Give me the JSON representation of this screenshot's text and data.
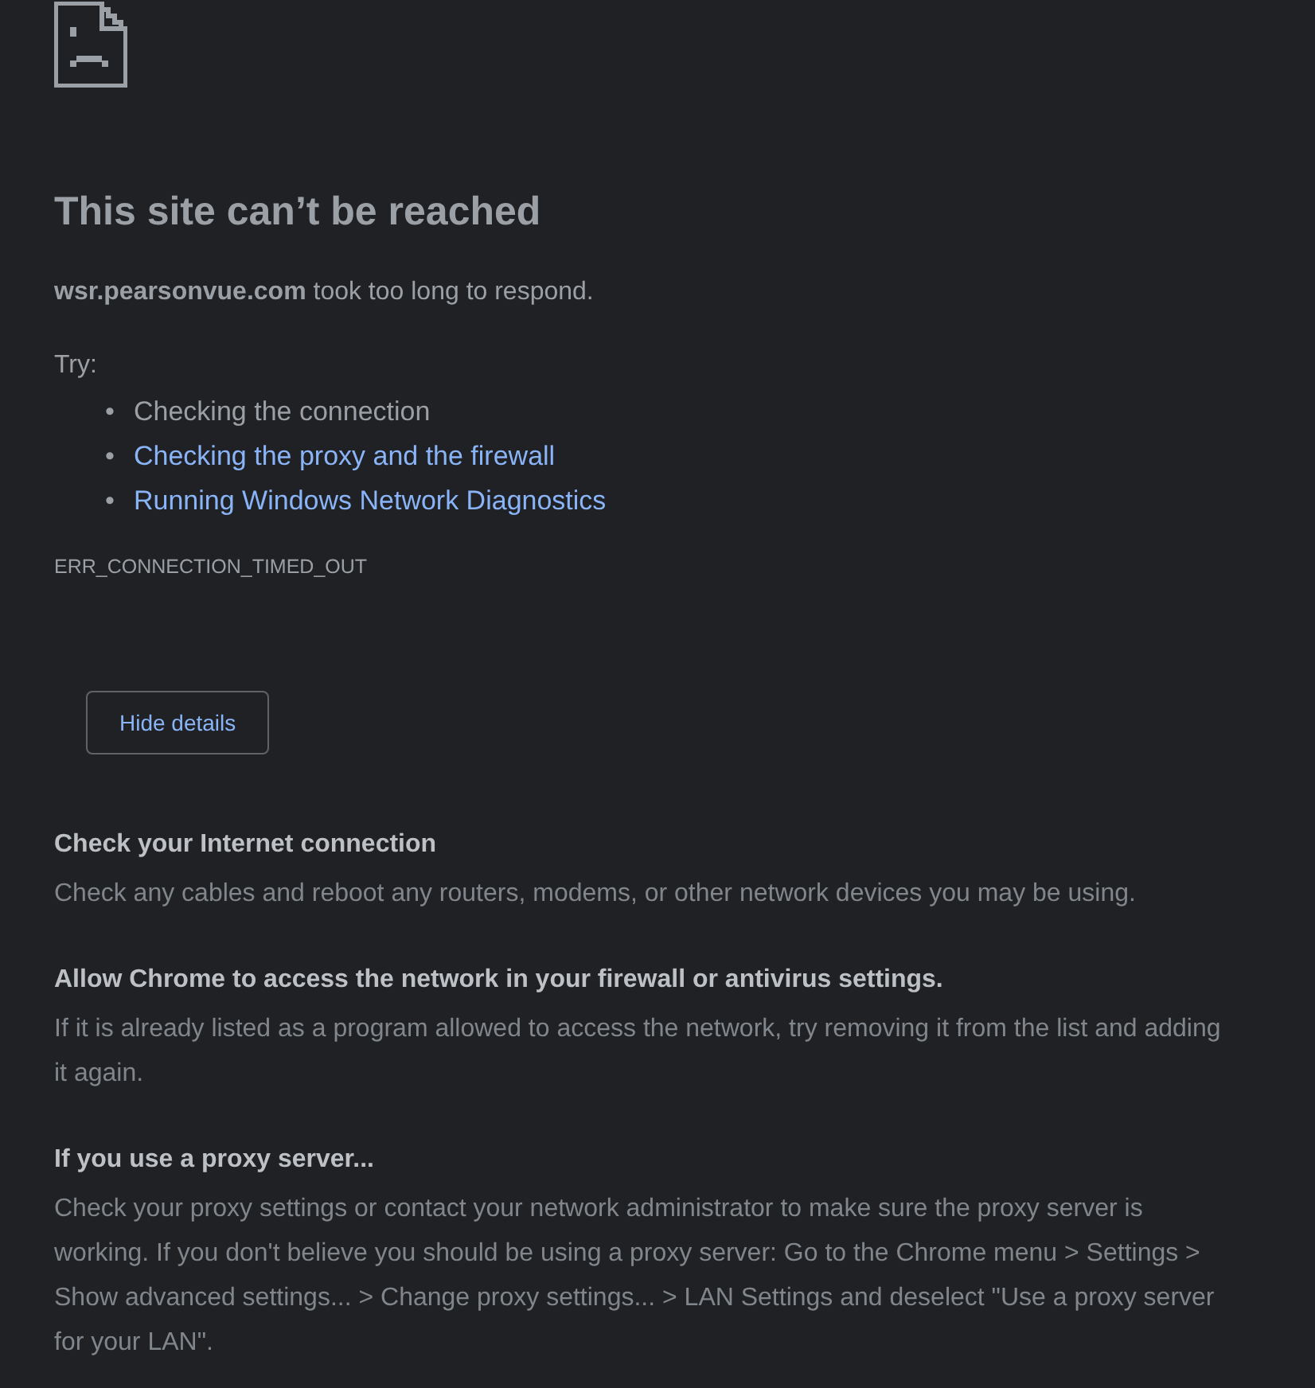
{
  "heading": "This site can’t be reached",
  "summary": "**wsr.pearsonvue.com** took too long to respond.",
  "try_label": "Try:",
  "suggestions": [
    {
      "bullet": "•",
      "text": "Checking the connection",
      "kind": "text"
    },
    {
      "bullet": "•",
      "text": "Checking the proxy and the firewall",
      "kind": "link"
    },
    {
      "bullet": "•",
      "text": "Running Windows Network Diagnostics",
      "kind": "link"
    }
  ],
  "error_code": "ERR_CONNECTION_TIMED_OUT",
  "details_button": "Hide details",
  "details": [
    {
      "title": "Check your Internet connection",
      "body": "Check any cables and reboot any routers, modems, or other network devices you may be using."
    },
    {
      "title": "Allow Chrome to access the network in your firewall or antivirus settings.",
      "body": "If it is already listed as a program allowed to access the network, try removing it from the list and adding it again."
    },
    {
      "title": "If you use a proxy server...",
      "body": "Check your proxy settings or contact your network administrator to make sure the proxy server is working. If you don't believe you should be using a proxy server: Go to the Chrome menu > Settings > Show advanced settings... > Change proxy settings... > LAN Settings and deselect \"Use a proxy server for your LAN\"."
    }
  ]
}
